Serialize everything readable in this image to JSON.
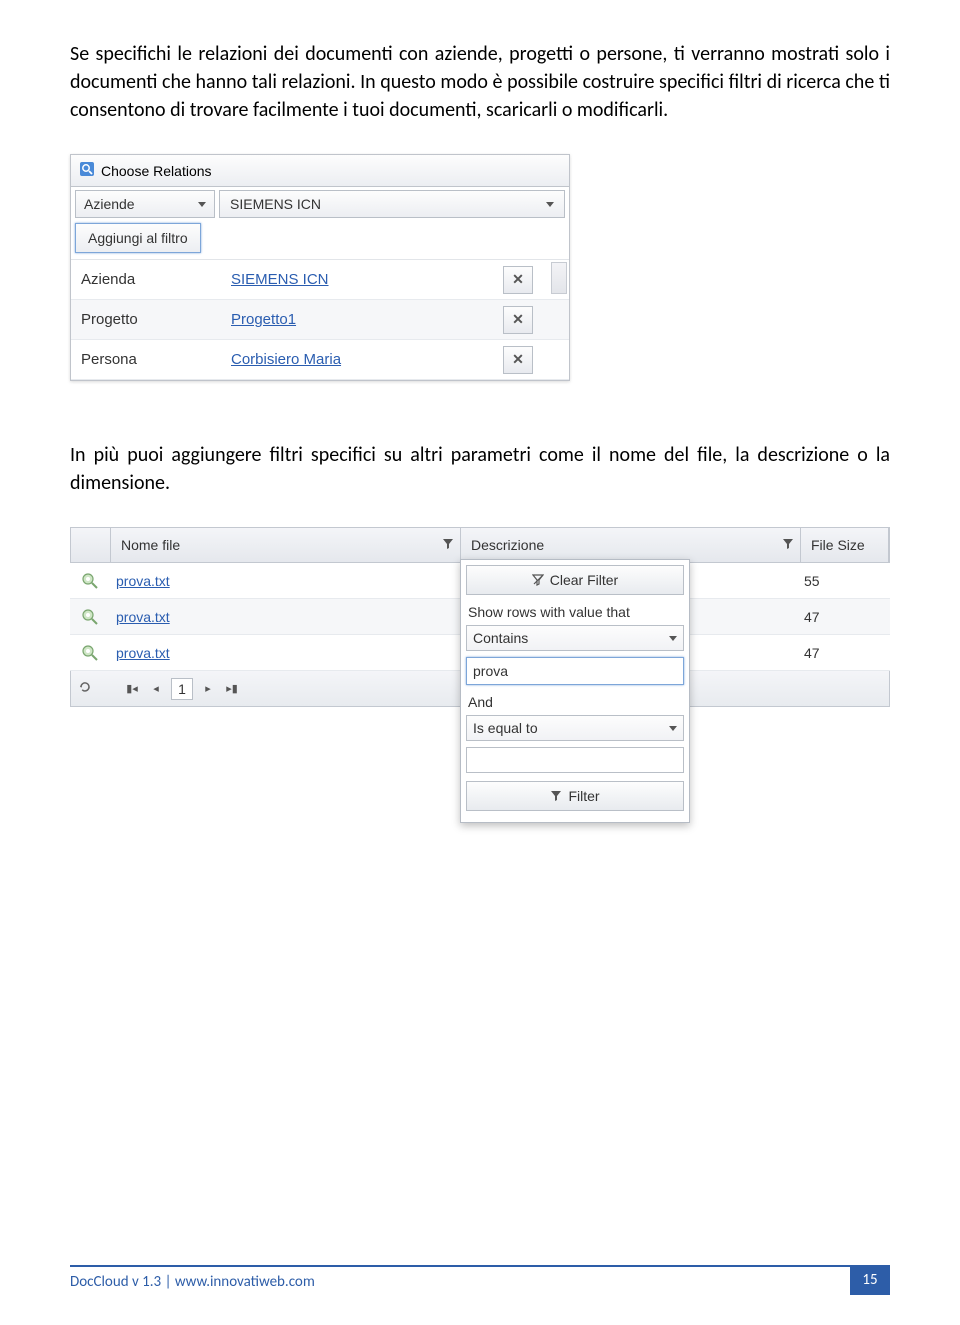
{
  "paragraphs": {
    "p1": "Se specifichi le relazioni dei documenti con aziende, progetti o persone, ti verranno mostrati solo i documenti che hanno tali relazioni. In questo modo è possibile costruire specifici filtri di ricerca che ti consentono di trovare facilmente i tuoi documenti, scaricarli o modificarli.",
    "p2": "In più puoi aggiungere filtri specifici su altri parametri come il nome del file, la descrizione o la dimensione."
  },
  "relations": {
    "panel_title": "Choose Relations",
    "type_selected": "Aziende",
    "name_selected": "SIEMENS ICN",
    "add_button": "Aggiungi al filtro",
    "rows": [
      {
        "label": "Azienda",
        "value": "SIEMENS ICN"
      },
      {
        "label": "Progetto",
        "value": "Progetto1"
      },
      {
        "label": "Persona",
        "value": "Corbisiero Maria"
      }
    ]
  },
  "grid": {
    "headers": {
      "name": "Nome file",
      "desc": "Descrizione",
      "size": "File Size"
    },
    "rows": [
      {
        "name": "prova.txt",
        "size": "55"
      },
      {
        "name": "prova.txt",
        "size": "47"
      },
      {
        "name": "prova.txt",
        "size": "47"
      }
    ],
    "page": "1"
  },
  "filter_popup": {
    "clear": "Clear Filter",
    "show_rows": "Show rows with value that",
    "op1": "Contains",
    "value1": "prova",
    "and": "And",
    "op2": "Is equal to",
    "apply": "Filter"
  },
  "footer": {
    "product": "DocCloud v 1.3",
    "site": "www.innovatiweb.com",
    "page": "15"
  }
}
